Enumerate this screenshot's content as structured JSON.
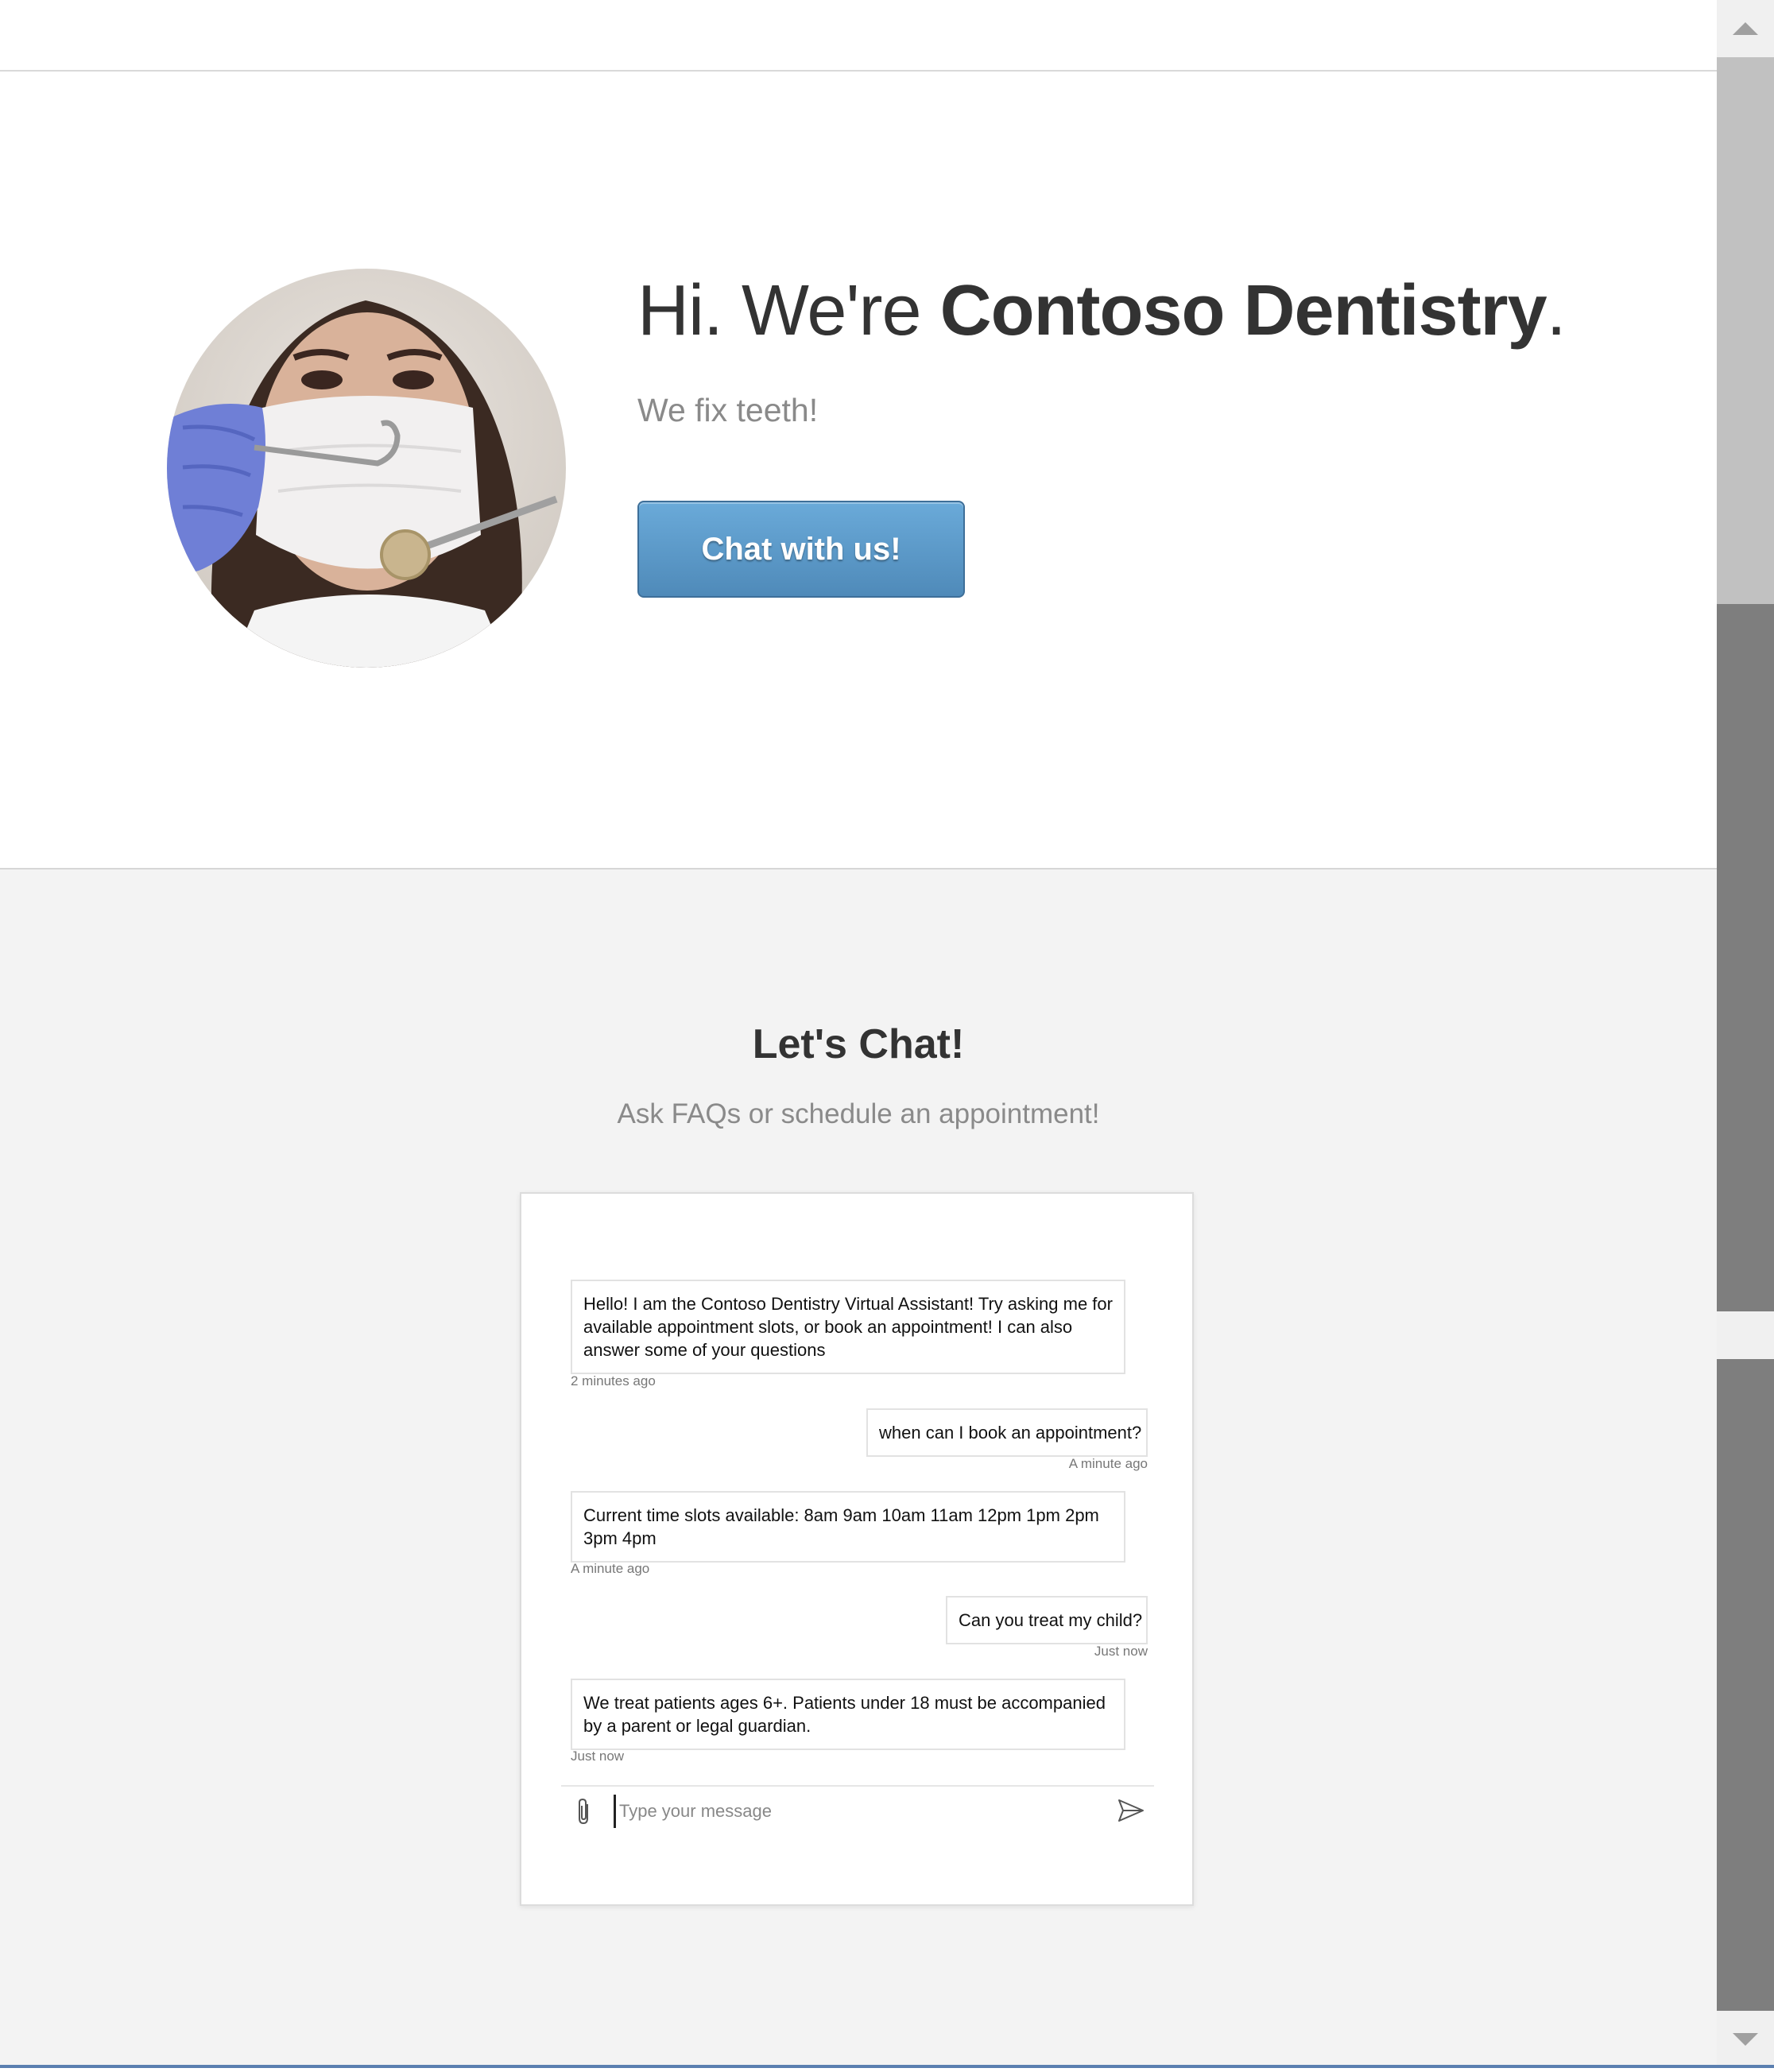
{
  "hero": {
    "title_prefix": "Hi. We're ",
    "title_brand": "Contoso Dentistry",
    "title_suffix": ".",
    "subtitle": "We fix teeth!",
    "chat_button": "Chat with us!",
    "avatar_icon": "dentist-photo"
  },
  "chat_section": {
    "title": "Let's Chat!",
    "subtitle": "Ask FAQs or schedule an appointment!"
  },
  "conversation": [
    {
      "from": "bot",
      "text": "Hello! I am the Contoso Dentistry Virtual Assistant! Try asking me for available appointment slots, or book an appointment! I can also answer some of your questions",
      "time": "2 minutes ago"
    },
    {
      "from": "user",
      "text": "when can I book an appointment?",
      "time": "A minute ago"
    },
    {
      "from": "bot",
      "text": "Current time slots available: 8am 9am 10am 11am 12pm 1pm 2pm 3pm 4pm",
      "time": "A minute ago"
    },
    {
      "from": "user",
      "text": "Can you treat my child?",
      "time": "Just now"
    },
    {
      "from": "bot",
      "text": "We treat patients ages 6+. Patients under 18 must be accompanied by a parent or legal guardian.",
      "time": "Just now"
    }
  ],
  "composer": {
    "placeholder": "Type your message",
    "attach_icon": "paperclip-icon",
    "send_icon": "send-icon"
  },
  "colors": {
    "button_top": "#6aaad9",
    "button_bottom": "#4f8ab9",
    "section_bg": "#f3f3f3"
  }
}
